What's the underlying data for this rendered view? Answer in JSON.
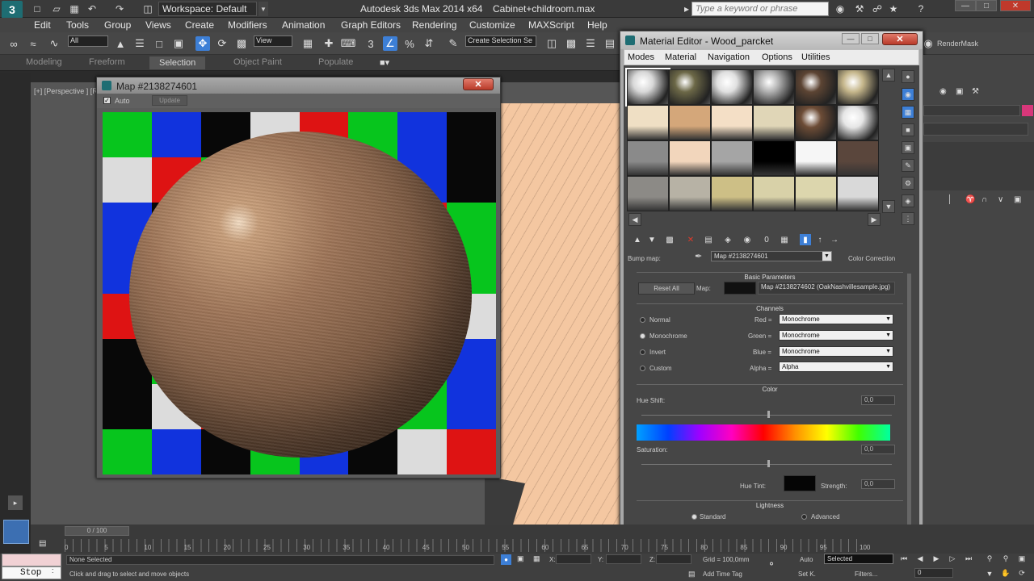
{
  "titlebar": {
    "workspace": "Workspace: Default",
    "app_title": "Autodesk 3ds Max  2014 x64",
    "file_title": "Cabinet+childroom.max",
    "search_placeholder": "Type a keyword or phrase"
  },
  "menubar": [
    "Edit",
    "Tools",
    "Group",
    "Views",
    "Create",
    "Modifiers",
    "Animation",
    "Graph Editors",
    "Rendering",
    "Customize",
    "MAXScript",
    "Help"
  ],
  "toolbar": {
    "selection_filter": "All",
    "ref_coord": "View",
    "named_selection": "Create Selection Se",
    "render_label": "RenderMask"
  },
  "ribbon": {
    "tabs": [
      "Modeling",
      "Freeform",
      "Selection",
      "Object Paint",
      "Populate"
    ],
    "active": "Selection"
  },
  "viewport": {
    "label": "[+] [Perspective ] [Realistic ]"
  },
  "map_window": {
    "title": "Map #2138274601",
    "auto_label": "Auto",
    "update_label": "Update",
    "checker_colors": [
      "#07c51d",
      "#1133dd",
      "#080808",
      "#dcdcdc",
      "#de1313",
      "#07c51d",
      "#1133dd",
      "#080808"
    ]
  },
  "material_editor": {
    "title": "Material Editor - Wood_parcket",
    "menus": [
      "Modes",
      "Material",
      "Navigation",
      "Options",
      "Utilities"
    ],
    "slot_colors": [
      "#d8d8d8",
      "#6c6847",
      "#e0e0e0",
      "#b0b0b0",
      "#5c4433",
      "#c5b68b",
      "#efdfc4",
      "#d4a77a",
      "#f4dfc6",
      "#e0d6b7",
      "#6d4c36",
      "#e6e6e6",
      "#8a8a8a",
      "#f2d6bc",
      "#a5a5a5",
      "#000000",
      "#f6f6f6",
      "#5a463c",
      "#8c8a86",
      "#b7b2a5",
      "#cdbf86",
      "#d8d1a8",
      "#dcd6ad",
      "#d9d9d9"
    ],
    "bump_label": "Bump map:",
    "bump_value": "Map #2138274601",
    "color_correction": "Color Correction",
    "basic_params": "Basic Parameters",
    "reset_all": "Reset All",
    "map_label": "Map:",
    "map_value": "Map #2138274602 (OakNashvillesample.jpg)",
    "channels": {
      "header": "Channels",
      "radios": [
        "Normal",
        "Monochrome",
        "Invert",
        "Custom"
      ],
      "selected_radio": "Monochrome",
      "rows": [
        {
          "label": "Red =",
          "value": "Monochrome"
        },
        {
          "label": "Green =",
          "value": "Monochrome"
        },
        {
          "label": "Blue =",
          "value": "Monochrome"
        },
        {
          "label": "Alpha =",
          "value": "Alpha"
        }
      ]
    },
    "color": {
      "header": "Color",
      "hue_shift_label": "Hue Shift:",
      "hue_shift_value": "0,0",
      "saturation_label": "Saturation:",
      "saturation_value": "0,0",
      "hue_tint_label": "Hue Tint:",
      "strength_label": "Strength:",
      "strength_value": "0,0"
    },
    "lightness": {
      "header": "Lightness",
      "standard": "Standard",
      "advanced": "Advanced",
      "selected": "Standard"
    }
  },
  "timeline": {
    "slider": "0 / 100",
    "ticks": [
      "0",
      "5",
      "10",
      "15",
      "20",
      "25",
      "30",
      "35",
      "40",
      "45",
      "50",
      "55",
      "60",
      "65",
      "70",
      "75",
      "80",
      "85",
      "90",
      "95",
      "100"
    ]
  },
  "statusbar": {
    "stop_label": "Stop",
    "status1": "None Selected",
    "status2": "Click and drag to select and move objects",
    "x_label": "X:",
    "y_label": "Y:",
    "z_label": "Z:",
    "grid": "Grid = 100,0mm",
    "add_time_tag": "Add Time Tag",
    "auto": "Auto",
    "selected": "Selected",
    "set_k": "Set K.",
    "filters": "Filters...",
    "frame": "0"
  }
}
